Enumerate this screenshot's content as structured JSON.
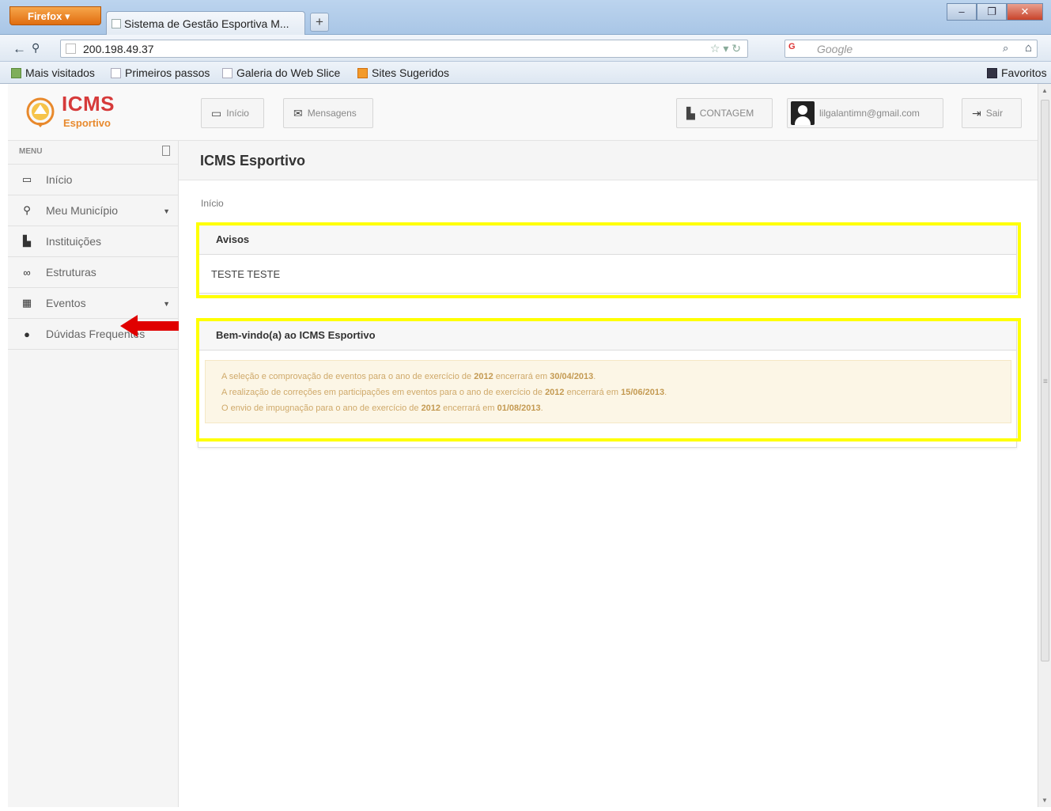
{
  "browser": {
    "app_button": "Firefox",
    "tab_title": "Sistema de Gestão Esportiva M...",
    "newtab_label": "+",
    "url": "200.198.49.37",
    "search_placeholder": "Google",
    "search_engine_label": "G",
    "bookmarks": [
      "Mais visitados",
      "Primeiros passos",
      "Galeria do Web Slice",
      "Sites Sugeridos"
    ],
    "favorites_label": "Favoritos"
  },
  "app": {
    "logo_title": "ICMS",
    "logo_subtitle": "Esportivo",
    "header_buttons": {
      "inicio": "Início",
      "mensagens": "Mensagens",
      "contagem": "CONTAGEM",
      "user_email": "lilgalantimn@gmail.com",
      "sair": "Sair"
    },
    "menu_title": "MENU",
    "menu_items": [
      {
        "label": "Início",
        "icon": "monitor-icon"
      },
      {
        "label": "Meu Município",
        "icon": "map-marker-icon",
        "has_submenu": true
      },
      {
        "label": "Instituições",
        "icon": "building-icon"
      },
      {
        "label": "Estruturas",
        "icon": "binoculars-icon"
      },
      {
        "label": "Eventos",
        "icon": "calendar-icon",
        "has_submenu": true
      },
      {
        "label": "Dúvidas Frequentes",
        "icon": "question-circle-icon"
      }
    ],
    "page_title": "ICMS Esportivo",
    "breadcrumb": "Início",
    "avisos": {
      "title": "Avisos",
      "body": "TESTE TESTE"
    },
    "welcome": {
      "title": "Bem-vindo(a) ao ICMS Esportivo",
      "lines": [
        {
          "text": "A seleção e comprovação de eventos para o ano de exercício de ",
          "year": "2012",
          "mid": " encerrará em ",
          "date": "30/04/2013",
          "end": "."
        },
        {
          "text": "A realização de correções em participações em eventos para o ano de exercício de ",
          "year": "2012",
          "mid": " encerrará em ",
          "date": "15/06/2013",
          "end": "."
        },
        {
          "text": "O envio de impugnação para o ano de exercício de ",
          "year": "2012",
          "mid": " encerrará em ",
          "date": "01/08/2013",
          "end": "."
        }
      ]
    }
  },
  "colors": {
    "brand_red": "#d63a3a",
    "brand_orange": "#e88a2e",
    "highlight": "#ffff00",
    "arrow": "#e00000",
    "alert_bg": "#fcf6e6",
    "alert_text": "#cfa96a"
  }
}
